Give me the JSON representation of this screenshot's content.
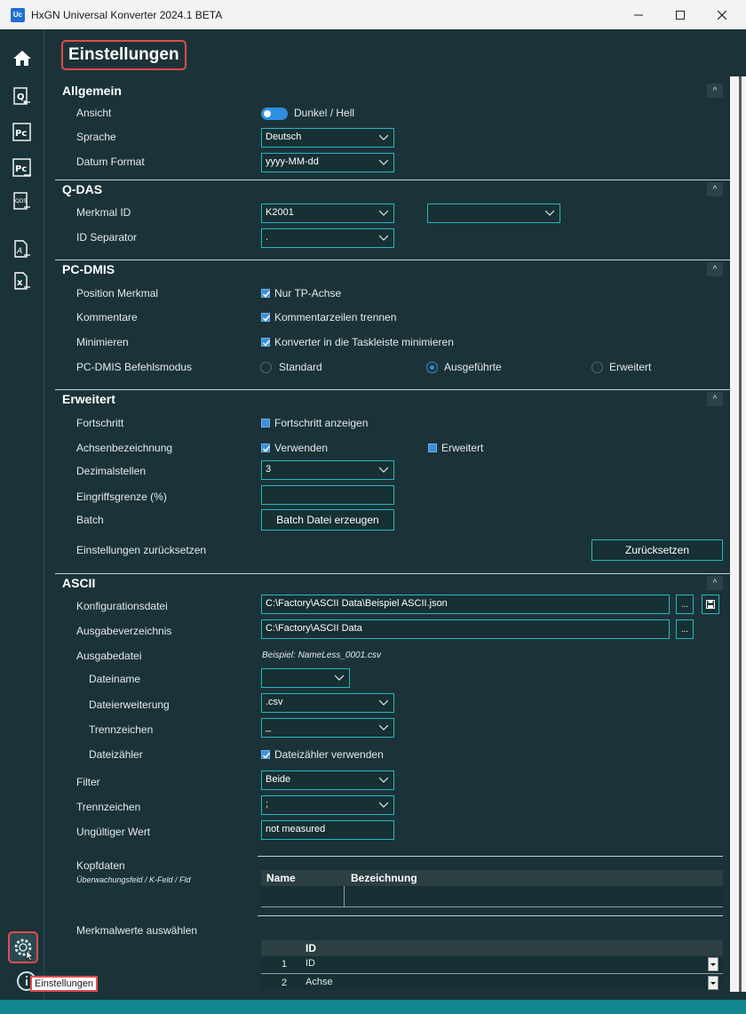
{
  "window": {
    "title": "HxGN Universal Konverter 2024.1 BETA",
    "icon_text": "Uc"
  },
  "page_title": "Einstellungen",
  "icons": {
    "home": "home-icon",
    "qdas_import": "q-import-icon",
    "pc": "pc-icon",
    "pc_export": "pc-export-icon",
    "qds": "qds-icon",
    "a_file": "a-file-icon",
    "x_file": "x-file-icon",
    "settings": "gear-icon",
    "info": "info-icon"
  },
  "nav": {
    "qds_label": "QDS",
    "pc_label": "Pc"
  },
  "tooltip": "Einstellungen",
  "collapse_glyph": "^",
  "colors": {
    "background": "#1b3338",
    "accent": "#28b7c0",
    "highlight": "#e04c4c",
    "check": "#3b8fd8"
  },
  "allgemein": {
    "title": "Allgemein",
    "ansicht_label": "Ansicht",
    "ansicht_value": "Dunkel / Hell",
    "sprache_label": "Sprache",
    "sprache_value": "Deutsch",
    "datum_label": "Datum Format",
    "datum_value": "yyyy-MM-dd"
  },
  "qdas": {
    "title": "Q-DAS",
    "merkmal_label": "Merkmal ID",
    "merkmal_value": "K2001",
    "merkmal_value2": "",
    "sep_label": "ID Separator",
    "sep_value": "."
  },
  "pcdmis": {
    "title": "PC-DMIS",
    "pos_label": "Position Merkmal",
    "pos_check": "Nur TP-Achse",
    "komm_label": "Kommentare",
    "komm_check": "Kommentarzeilen trennen",
    "min_label": "Minimieren",
    "min_check": "Konverter in die Taskleiste minimieren",
    "mode_label": "PC-DMIS Befehlsmodus",
    "mode_options": [
      "Standard",
      "Ausgeführte",
      "Erweitert"
    ],
    "mode_selected": "Ausgeführte"
  },
  "erweitert": {
    "title": "Erweitert",
    "fort_label": "Fortschritt",
    "fort_check": "Fortschritt anzeigen",
    "achs_label": "Achsenbezeichnung",
    "achs_check1": "Verwenden",
    "achs_check2": "Erweitert",
    "dez_label": "Dezimalstellen",
    "dez_value": "3",
    "eing_label": "Eingriffsgrenze (%)",
    "eing_value": "",
    "batch_label": "Batch",
    "batch_button": "Batch Datei erzeugen",
    "reset_label": "Einstellungen zurücksetzen",
    "reset_button": "Zurücksetzen"
  },
  "ascii": {
    "title": "ASCII",
    "konf_label": "Konfigurationsdatei",
    "konf_value": "C:\\Factory\\ASCII Data\\Beispiel ASCII.json",
    "browse_glyph": "...",
    "ausg_label": "Ausgabeverzeichnis",
    "ausg_value": "C:\\Factory\\ASCII Data",
    "datei_label": "Ausgabedatei",
    "datei_example": "Beispiel:  NameLess_0001.csv",
    "name_label": "Dateiname",
    "name_value": "",
    "ext_label": "Dateierweiterung",
    "ext_value": ".csv",
    "trenn_label": "Trennzeichen",
    "trenn_value": "_",
    "zaehl_label": "Dateizähler",
    "zaehl_check": "Dateizähler verwenden",
    "filter_label": "Filter",
    "filter_value": "Beide",
    "trenn2_label": "Trennzeichen",
    "trenn2_value": ";",
    "ungueltig_label": "Ungültiger Wert",
    "ungueltig_value": "not measured",
    "kopf_label": "Kopfdaten",
    "kopf_sub": "Überwachungsfeld / K-Feld / Fld",
    "kopf_columns": [
      "Name",
      "Bezeichnung"
    ],
    "merk_label": "Merkmalwerte auswählen",
    "merk_column": "ID",
    "merk_rows": [
      {
        "num": "1",
        "value": "ID"
      },
      {
        "num": "2",
        "value": "Achse"
      }
    ]
  }
}
